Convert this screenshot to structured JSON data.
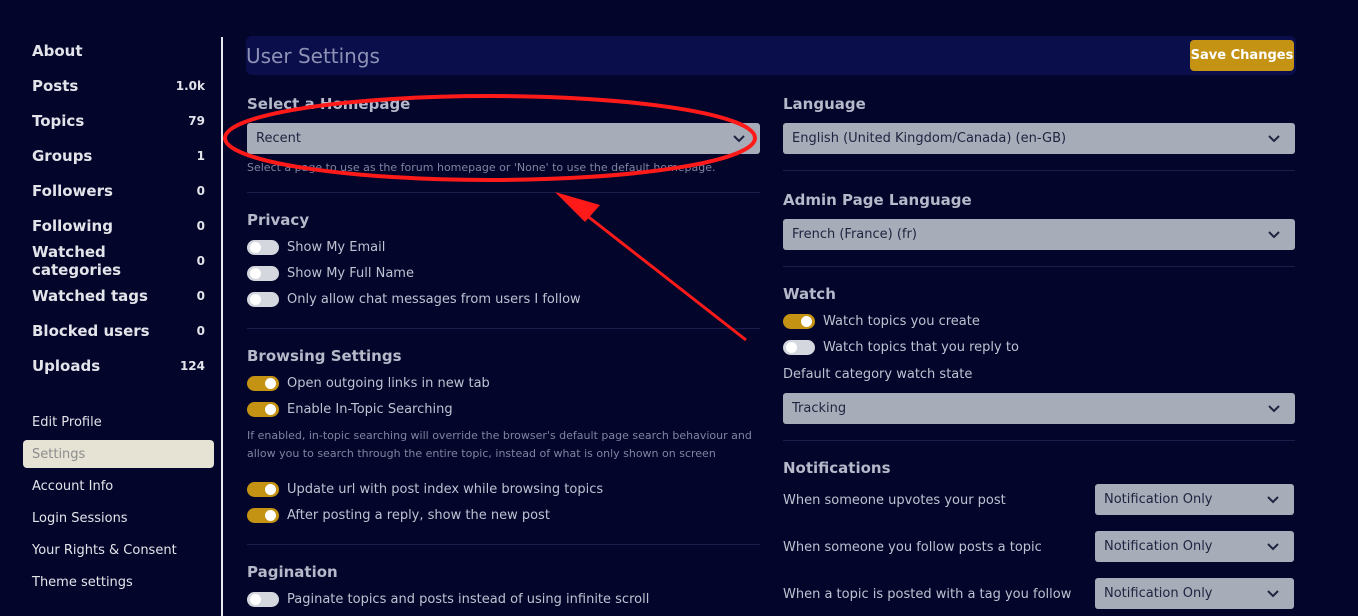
{
  "sidebar": {
    "counts": [
      {
        "label": "About",
        "count": ""
      },
      {
        "label": "Posts",
        "count": "1.0k"
      },
      {
        "label": "Topics",
        "count": "79"
      },
      {
        "label": "Groups",
        "count": "1"
      },
      {
        "label": "Followers",
        "count": "0"
      },
      {
        "label": "Following",
        "count": "0"
      },
      {
        "label": "Watched categories",
        "count": "0"
      },
      {
        "label": "Watched tags",
        "count": "0"
      },
      {
        "label": "Blocked users",
        "count": "0"
      },
      {
        "label": "Uploads",
        "count": "124"
      }
    ],
    "links": [
      {
        "label": "Edit Profile",
        "active": false
      },
      {
        "label": "Settings",
        "active": true
      },
      {
        "label": "Account Info",
        "active": false
      },
      {
        "label": "Login Sessions",
        "active": false
      },
      {
        "label": "Your Rights & Consent",
        "active": false
      },
      {
        "label": "Theme settings",
        "active": false
      }
    ]
  },
  "header": {
    "title": "User Settings",
    "save_label": "Save Changes"
  },
  "left": {
    "homepage": {
      "title": "Select a Homepage",
      "value": "Recent",
      "help": "Select a page to use as the forum homepage or 'None' to use the default homepage."
    },
    "privacy": {
      "title": "Privacy",
      "toggles": [
        {
          "label": "Show My Email",
          "on": false
        },
        {
          "label": "Show My Full Name",
          "on": false
        },
        {
          "label": "Only allow chat messages from users I follow",
          "on": false
        }
      ]
    },
    "browsing": {
      "title": "Browsing Settings",
      "toggles": [
        {
          "label": "Open outgoing links in new tab",
          "on": true
        },
        {
          "label": "Enable In-Topic Searching",
          "on": true
        }
      ],
      "help_line1": "If enabled, in-topic searching will override the browser's default page search behaviour and",
      "help_line2": "allow you to search through the entire topic, instead of what is only shown on screen",
      "toggles2": [
        {
          "label": "Update url with post index while browsing topics",
          "on": true
        },
        {
          "label": "After posting a reply, show the new post",
          "on": true
        }
      ]
    },
    "pagination": {
      "title": "Pagination",
      "toggles": [
        {
          "label": "Paginate topics and posts instead of using infinite scroll",
          "on": false
        }
      ]
    }
  },
  "right": {
    "language": {
      "title": "Language",
      "value": "English (United Kingdom/Canada) (en-GB)"
    },
    "admin_language": {
      "title": "Admin Page Language",
      "value": "French (France) (fr)"
    },
    "watch": {
      "title": "Watch",
      "toggles": [
        {
          "label": "Watch topics you create",
          "on": true
        },
        {
          "label": "Watch topics that you reply to",
          "on": false
        }
      ],
      "default_state_label": "Default category watch state",
      "default_state_value": "Tracking"
    },
    "notifications": {
      "title": "Notifications",
      "rows": [
        {
          "label": "When someone upvotes your post",
          "value": "Notification Only"
        },
        {
          "label": "When someone you follow posts a topic",
          "value": "Notification Only"
        },
        {
          "label": "When a topic is posted with a tag you follow",
          "value": "Notification Only"
        }
      ]
    }
  },
  "colors": {
    "background": "#03052b",
    "accent": "#c59313",
    "annotation": "#ff1a1a"
  }
}
